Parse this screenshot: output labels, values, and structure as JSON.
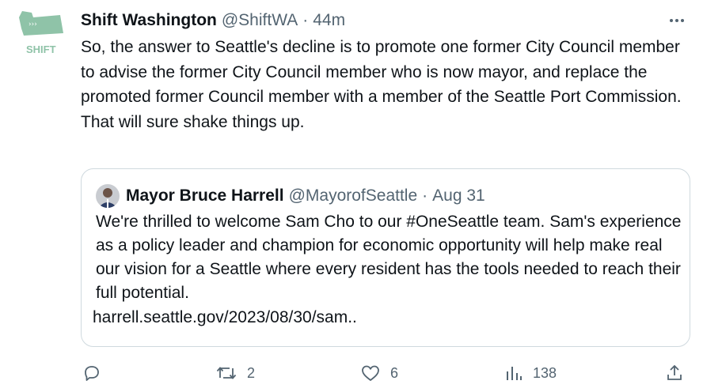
{
  "tweet": {
    "avatar_label": "SHIFT",
    "display_name": "Shift Washington",
    "handle": "@ShiftWA",
    "separator": "·",
    "time": "44m",
    "text": "So, the answer to Seattle's decline is to promote one former City Council member to advise the former City Council member who is now mayor, and replace the promoted former Council member with a member of the Seattle Port Commission.\nThat will sure shake things up."
  },
  "quote": {
    "display_name": "Mayor Bruce Harrell",
    "handle": "@MayorofSeattle",
    "separator": "·",
    "time": "Aug 31",
    "text": "We're thrilled to welcome Sam Cho to our #OneSeattle team. Sam's experience as a policy leader and champion for economic opportunity will help make real our vision for a Seattle where every resident has the tools needed to reach their full potential.",
    "link": "harrell.seattle.gov/2023/08/30/sam.."
  },
  "actions": {
    "replies": "",
    "retweets": "2",
    "likes": "6",
    "views": "138"
  },
  "colors": {
    "brand_green": "#8fc3a8",
    "muted": "#536471",
    "border": "#cfd9de"
  },
  "icons": [
    "shift-logo",
    "more-icon",
    "reply-icon",
    "retweet-icon",
    "like-icon",
    "views-icon",
    "share-icon"
  ]
}
